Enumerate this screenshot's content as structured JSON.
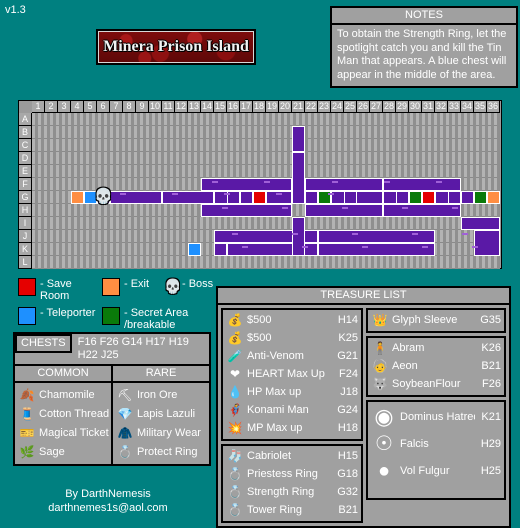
{
  "version": "v1.3",
  "title": "Minera Prison Island",
  "notes": {
    "header": "NOTES",
    "body": "To obtain the Strength Ring, let the spotlight catch you and kill the Tin Man that appears. A blue chest will appear in the middle of the area."
  },
  "map": {
    "columns": [
      "1",
      "2",
      "3",
      "4",
      "5",
      "6",
      "7",
      "8",
      "9",
      "10",
      "11",
      "12",
      "13",
      "14",
      "15",
      "16",
      "17",
      "18",
      "19",
      "20",
      "21",
      "22",
      "23",
      "24",
      "25",
      "26",
      "27",
      "28",
      "29",
      "30",
      "31",
      "32",
      "33",
      "34",
      "35",
      "36"
    ],
    "rows": [
      "A",
      "B",
      "C",
      "D",
      "E",
      "F",
      "G",
      "H",
      "I",
      "J",
      "K",
      "L"
    ],
    "colors": {
      "room": "#5a19a6",
      "save": "#e50000",
      "exit": "#ff8e42",
      "teleporter": "#1e90ff",
      "secret": "#0a7a0a",
      "grid": "#a3a3a3",
      "wall": "#ffffff"
    },
    "boss_marker": "skull-icon"
  },
  "legend": {
    "items": [
      {
        "swatch": "red",
        "label": "- Save Room"
      },
      {
        "swatch": "orange",
        "label": "- Exit"
      },
      {
        "swatch": "skull",
        "label": "- Boss"
      },
      {
        "swatch": "blue",
        "label": "- Teleporter"
      },
      {
        "swatch": "green",
        "label": "- Secret Area\n/breakable"
      }
    ]
  },
  "chests": {
    "label": "CHESTS",
    "codes": "F16  F26  G14  H17  H19\nH22  J25",
    "common_header": "COMMON",
    "rare_header": "RARE",
    "common": [
      {
        "icon": "chamomile-icon",
        "name": "Chamomile"
      },
      {
        "icon": "cotton-thread-icon",
        "name": "Cotton Thread"
      },
      {
        "icon": "magical-ticket-icon",
        "name": "Magical Ticket"
      },
      {
        "icon": "sage-icon",
        "name": "Sage"
      }
    ],
    "rare": [
      {
        "icon": "iron-ore-icon",
        "name": "Iron Ore"
      },
      {
        "icon": "lapis-lazuli-icon",
        "name": "Lapis Lazuli"
      },
      {
        "icon": "military-wear-icon",
        "name": "Military Wear"
      },
      {
        "icon": "protect-ring-icon",
        "name": "Protect Ring"
      }
    ]
  },
  "treasure": {
    "header": "TREASURE LIST",
    "left_groups": [
      [
        {
          "icon": "money-bag-icon",
          "name": "$500",
          "loc": "H14"
        },
        {
          "icon": "money-bag-icon",
          "name": "$500",
          "loc": "K25"
        },
        {
          "icon": "anti-venom-icon",
          "name": "Anti-Venom",
          "loc": "G21"
        },
        {
          "icon": "heart-max-icon",
          "name": "HEART Max Up",
          "loc": "F24"
        },
        {
          "icon": "hp-max-icon",
          "name": "HP Max up",
          "loc": "J18"
        },
        {
          "icon": "konami-man-icon",
          "name": "Konami Man",
          "loc": "G24"
        },
        {
          "icon": "mp-max-icon",
          "name": "MP Max up",
          "loc": "H18"
        }
      ],
      [
        {
          "icon": "cabriolet-icon",
          "name": "Cabriolet",
          "loc": "H15"
        },
        {
          "icon": "priestess-ring-icon",
          "name": "Priestess Ring",
          "loc": "G18"
        },
        {
          "icon": "strength-ring-icon",
          "name": "Strength Ring",
          "loc": "G32"
        },
        {
          "icon": "tower-ring-icon",
          "name": "Tower Ring",
          "loc": "B21"
        }
      ]
    ],
    "right_groups": [
      [
        {
          "icon": "glyph-sleeve-icon",
          "name": "Glyph Sleeve",
          "loc": "G35"
        }
      ],
      [
        {
          "icon": "abram-icon",
          "name": "Abram",
          "loc": "K26"
        },
        {
          "icon": "aeon-icon",
          "name": "Aeon",
          "loc": "B21"
        },
        {
          "icon": "soybeanflour-icon",
          "name": "SoybeanFlour",
          "loc": "F26"
        }
      ],
      [
        {
          "icon": "dominus-hatred-icon",
          "name": "Dominus Hatred",
          "loc": "K21"
        },
        {
          "icon": "falcis-icon",
          "name": "Falcis",
          "loc": "H29"
        },
        {
          "icon": "vol-fulgur-icon",
          "name": "Vol Fulgur",
          "loc": "H25"
        }
      ]
    ]
  },
  "credits": {
    "author": "By DarthNemesis",
    "email": "darthnemes1s@aol.com"
  }
}
